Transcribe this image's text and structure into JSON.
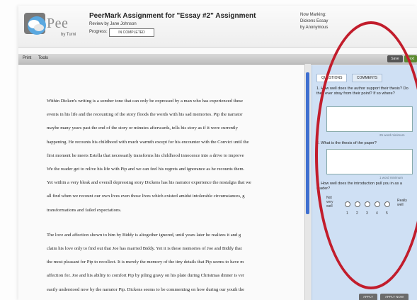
{
  "header": {
    "title": "PeerMark Assignment for \"Essay #2\" Assignment",
    "brand": "Pee",
    "brand_sub": "by Turni",
    "reviewby": "Review by Jane Johnson",
    "progress_label": "Progress:",
    "progress_value": "IN COMPLETED",
    "marking_lines": [
      "Now Marking:",
      "Dickens Essay",
      "by Anonymous"
    ]
  },
  "toolbar": {
    "items": [
      "Print",
      "Tools"
    ],
    "save_label": "Save",
    "next_label": "Next"
  },
  "document": {
    "paragraph1": [
      "Within Dicken's writing is a somber tone that can only be expressed by a man who has experienced these",
      "events in his life and the recounting of the story floods the words with his sad memories. Pip the narrator",
      "maybe many years past the end of the story or minutes afterwards, tells his story as if it were currently",
      "happening. He recounts his childhood with much warmth except for his encounter with the Convict until the",
      "first moment he meets Estella that necessarily transforms his childhood innocence into a drive to improve",
      "We the reader get to relive his life with Pip and we can feel his regrets and ignorance as he recounts them.",
      "Yet within a very bleak and overall depressing story Dickens has his narrator experience the nostalgia that we",
      "all find when we recount our own lives even those lives which existed amidst intolerable circumstances, g",
      "transformations and failed expectations."
    ],
    "paragraph2": [
      "The love and affection shown to him by Biddy is altogether ignored, until years later he realizes it and g",
      "claim his love only to find out that Joe has married Biddy. Yet it is these memories of Joe and Biddy that",
      "the most pleasant for Pip to recollect. It is merely the memory of the tiny details that Pip seems to have m",
      "affection for. Joe and his ability to comfort Pip by piling gravy on his plate during Christmas dinner is ver",
      "easily understood now by the narrator Pip. Dickens seems to be commenting on how during our youth the"
    ]
  },
  "panel": {
    "tabs": [
      "QUESTIONS",
      "COMMENTS"
    ],
    "questions": [
      {
        "num": "1.",
        "text": "How well does the author support their thesis? Do they ever stray from their point? If so where?",
        "minimum": "25 word minimum"
      },
      {
        "num": "2.",
        "text": "What is the thesis of the paper?",
        "minimum": "1 word minimum"
      },
      {
        "num": "3.",
        "text": "How well does the introduction pull you in as a reader?"
      }
    ],
    "scale_left": "Not very well",
    "scale_right": "Really well",
    "scale_numbers": [
      "1",
      "2",
      "3",
      "4",
      "5"
    ],
    "buttons": [
      "APPLY",
      "APPLY NOW"
    ]
  },
  "colors": {
    "highlight_oval": "#c21d2c",
    "scroll_thumb": "#3f6fd0",
    "panel_bg": "#cfe0f4"
  }
}
